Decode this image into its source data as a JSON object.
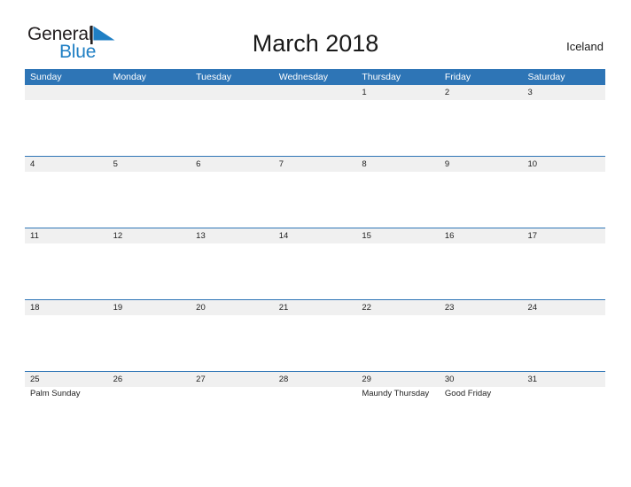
{
  "brand": {
    "name_part1": "General",
    "name_part2": "Blue",
    "flag_icon": "blue-triangle-flag-icon",
    "accent_color": "#1f7fc4"
  },
  "header": {
    "title": "March 2018",
    "region": "Iceland"
  },
  "theme": {
    "header_blue": "#2e75b6",
    "date_strip_gray": "#f0f0f0",
    "page_background": "#ffffff",
    "text_color": "#222222"
  },
  "calendar": {
    "month": "March",
    "year": "2018",
    "weekdays": [
      "Sunday",
      "Monday",
      "Tuesday",
      "Wednesday",
      "Thursday",
      "Friday",
      "Saturday"
    ],
    "weeks": [
      {
        "days": [
          {
            "date": "",
            "event": ""
          },
          {
            "date": "",
            "event": ""
          },
          {
            "date": "",
            "event": ""
          },
          {
            "date": "",
            "event": ""
          },
          {
            "date": "1",
            "event": ""
          },
          {
            "date": "2",
            "event": ""
          },
          {
            "date": "3",
            "event": ""
          }
        ]
      },
      {
        "days": [
          {
            "date": "4",
            "event": ""
          },
          {
            "date": "5",
            "event": ""
          },
          {
            "date": "6",
            "event": ""
          },
          {
            "date": "7",
            "event": ""
          },
          {
            "date": "8",
            "event": ""
          },
          {
            "date": "9",
            "event": ""
          },
          {
            "date": "10",
            "event": ""
          }
        ]
      },
      {
        "days": [
          {
            "date": "11",
            "event": ""
          },
          {
            "date": "12",
            "event": ""
          },
          {
            "date": "13",
            "event": ""
          },
          {
            "date": "14",
            "event": ""
          },
          {
            "date": "15",
            "event": ""
          },
          {
            "date": "16",
            "event": ""
          },
          {
            "date": "17",
            "event": ""
          }
        ]
      },
      {
        "days": [
          {
            "date": "18",
            "event": ""
          },
          {
            "date": "19",
            "event": ""
          },
          {
            "date": "20",
            "event": ""
          },
          {
            "date": "21",
            "event": ""
          },
          {
            "date": "22",
            "event": ""
          },
          {
            "date": "23",
            "event": ""
          },
          {
            "date": "24",
            "event": ""
          }
        ]
      },
      {
        "days": [
          {
            "date": "25",
            "event": "Palm Sunday"
          },
          {
            "date": "26",
            "event": ""
          },
          {
            "date": "27",
            "event": ""
          },
          {
            "date": "28",
            "event": ""
          },
          {
            "date": "29",
            "event": "Maundy Thursday"
          },
          {
            "date": "30",
            "event": "Good Friday"
          },
          {
            "date": "31",
            "event": ""
          }
        ]
      }
    ]
  }
}
